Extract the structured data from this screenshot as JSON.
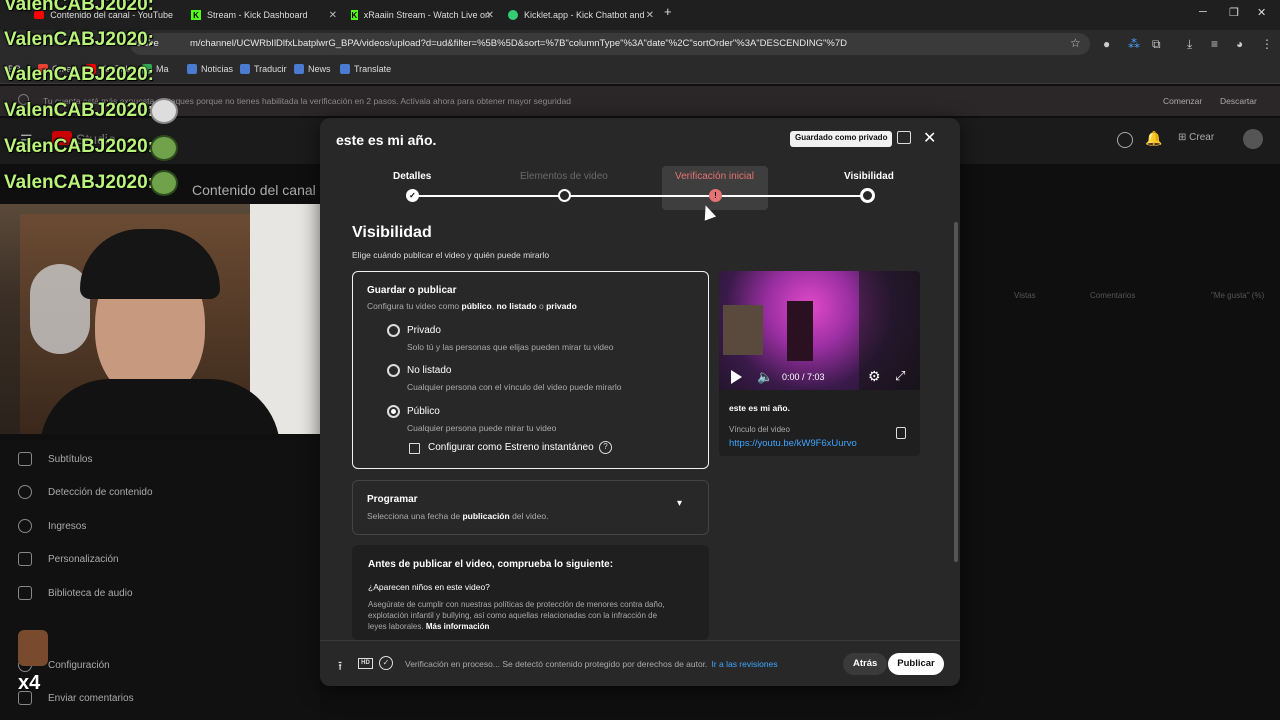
{
  "browser": {
    "tabs": [
      {
        "title": "Contenido del canal - YouTube"
      },
      {
        "title": "Stream - Kick Dashboard"
      },
      {
        "title": "xRaaiin Stream - Watch Live on"
      },
      {
        "title": "Kicklet.app - Kick Chatbot and"
      }
    ],
    "new_tab": "+",
    "url": "m/channel/UCWRbIlDlfxLbatplwrG_BPA/videos/upload?d=ud&filter=%5B%5D&sort=%7B\"columnType\"%3A\"date\"%2C\"sortOrder\"%3A\"DESCENDING\"%7D",
    "url_prefix": "utube",
    "bookmarks": [
      "Noticias",
      "Traducir",
      "News",
      "Translate"
    ],
    "bookmark_partial": [
      "BR",
      "Gmail",
      "YouTube",
      "Ma"
    ]
  },
  "warning": {
    "text": "Tu cuenta está más expuesta a ataques porque no tienes habilitada la verificación en 2 pasos. Actívala ahora para obtener mayor seguridad",
    "start_button": "Comenzar",
    "dismiss_button": "Descartar"
  },
  "studio": {
    "logo": "Studio",
    "create": "Crear",
    "page_heading": "Contenido del canal",
    "columns": [
      "Vistas",
      "Comentarios",
      "\"Me gusta\" (%)"
    ],
    "sidebar": [
      {
        "label": "Subtítulos"
      },
      {
        "label": "Detección de contenido"
      },
      {
        "label": "Ingresos"
      },
      {
        "label": "Personalización"
      },
      {
        "label": "Biblioteca de audio"
      },
      {
        "label": "Configuración"
      },
      {
        "label": "Enviar comentarios"
      }
    ]
  },
  "chat_overlay": {
    "user": "ValenCABJ2020:",
    "lines": 6
  },
  "dialog": {
    "title": "este es mi año.",
    "saved_badge": "Guardado como privado",
    "steps": [
      {
        "label": "Detalles",
        "state": "done"
      },
      {
        "label": "Elementos de video",
        "state": "inactive"
      },
      {
        "label": "Verificación inicial",
        "state": "warning"
      },
      {
        "label": "Visibilidad",
        "state": "current"
      }
    ],
    "visibility": {
      "title": "Visibilidad",
      "subtitle": "Elige cuándo publicar el video y quién puede mirarlo",
      "save_heading": "Guardar o publicar",
      "save_desc_pre": "Configura tu video como ",
      "save_desc_public": "público",
      "save_desc_sep1": ", ",
      "save_desc_unlisted": "no listado",
      "save_desc_sep2": " o ",
      "save_desc_private": "privado",
      "options": [
        {
          "label": "Privado",
          "desc": "Solo tú y las personas que elijas pueden mirar tu video",
          "selected": false
        },
        {
          "label": "No listado",
          "desc": "Cualquier persona con el vínculo del video puede mirarlo",
          "selected": false
        },
        {
          "label": "Público",
          "desc": "Cualquier persona puede mirar tu video",
          "selected": true
        }
      ],
      "premiere_label": "Configurar como Estreno instantáneo",
      "premiere_checked": false,
      "help": "?"
    },
    "schedule": {
      "heading": "Programar",
      "desc_pre": "Selecciona una fecha de ",
      "desc_bold": "publicación",
      "desc_post": " del video."
    },
    "checklist": {
      "title": "Antes de publicar el video, comprueba lo siguiente:",
      "question": "¿Aparecen niños en este video?",
      "body": "Asegúrate de cumplir con nuestras políticas de protección de menores contra daño, explotación infantil y bullying, así como aquellas relacionadas con la infracción de leyes laborales.",
      "more": "Más información"
    },
    "preview": {
      "time": "0:00 / 7:03",
      "title": "este es mi año.",
      "link_label": "Vínculo del video",
      "link": "https://youtu.be/kW9F6xUurvo"
    },
    "footer": {
      "hd": "HD",
      "status": "Verificación en proceso... Se detectó contenido protegido por derechos de autor.",
      "review_link": "Ir a las revisiones",
      "back": "Atrás",
      "publish": "Publicar"
    }
  },
  "colors": {
    "accent_link": "#3ea6ff",
    "warning_step": "#e57373",
    "chat_name": "#b9f37a"
  }
}
